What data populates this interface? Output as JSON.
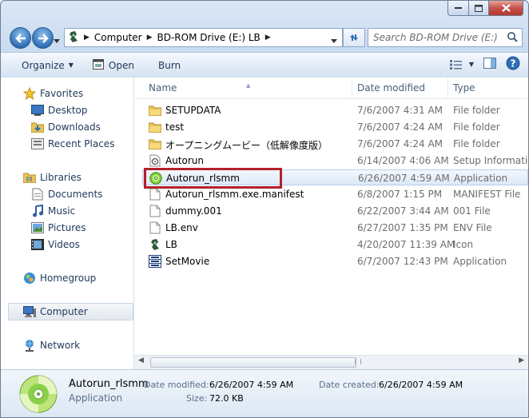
{
  "breadcrumb": [
    "Computer",
    "BD-ROM Drive (E:) LB"
  ],
  "search_placeholder": "Search BD-ROM Drive (E:) LB",
  "toolbar": {
    "organize": "Organize",
    "open": "Open",
    "burn": "Burn"
  },
  "nav": {
    "favorites": "Favorites",
    "favorites_items": [
      "Desktop",
      "Downloads",
      "Recent Places"
    ],
    "libraries": "Libraries",
    "libraries_items": [
      "Documents",
      "Music",
      "Pictures",
      "Videos"
    ],
    "homegroup": "Homegroup",
    "computer": "Computer",
    "network": "Network"
  },
  "columns": {
    "name": "Name",
    "date": "Date modified",
    "type": "Type"
  },
  "files": [
    {
      "name": "SETUPDATA",
      "date": "7/6/2007 4:31 AM",
      "type": "File folder",
      "icon": "folder-icon"
    },
    {
      "name": "test",
      "date": "7/6/2007 4:24 AM",
      "type": "File folder",
      "icon": "folder-icon"
    },
    {
      "name": "オープニングムービー（低解像度版）",
      "date": "7/6/2007 4:24 AM",
      "type": "File folder",
      "icon": "folder-icon"
    },
    {
      "name": "Autorun",
      "date": "6/14/2007 4:06 AM",
      "type": "Setup Information",
      "icon": "setup-info-icon"
    },
    {
      "name": "Autorun_rlsmm",
      "date": "6/26/2007 4:59 AM",
      "type": "Application",
      "icon": "disc-app-icon"
    },
    {
      "name": "Autorun_rlsmm.exe.manifest",
      "date": "6/8/2007 1:15 PM",
      "type": "MANIFEST File",
      "icon": "file-icon"
    },
    {
      "name": "dummy.001",
      "date": "6/22/2007 3:44 AM",
      "type": "001 File",
      "icon": "file-icon"
    },
    {
      "name": "LB.env",
      "date": "6/27/2007 1:35 PM",
      "type": "ENV File",
      "icon": "file-icon"
    },
    {
      "name": "LB",
      "date": "4/20/2007 11:39 AM",
      "type": "Icon",
      "icon": "lb-icon"
    },
    {
      "name": "SetMovie",
      "date": "6/7/2007 12:43 PM",
      "type": "Application",
      "icon": "movie-app-icon"
    }
  ],
  "details": {
    "name": "Autorun_rlsmm",
    "type": "Application",
    "date_modified_label": "Date modified:",
    "date_modified": "6/26/2007 4:59 AM",
    "date_created_label": "Date created:",
    "date_created": "6/26/2007 4:59 AM",
    "size_label": "Size:",
    "size": "72.0 KB"
  },
  "colors": {
    "highlight_box": "#b3212b",
    "selection": "#dde9f7"
  }
}
